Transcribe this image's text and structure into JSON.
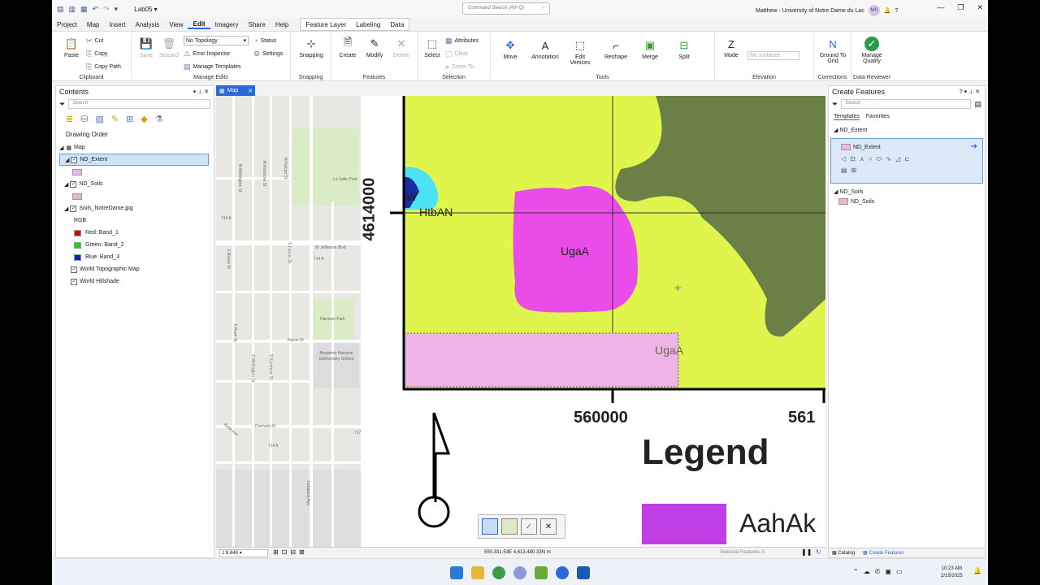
{
  "titlebar": {
    "project": "Lab05",
    "command_search": "Command Search (Alt+Q)",
    "user": "Matthew - University of Notre Dame du Lac",
    "initials": "MS"
  },
  "menu": [
    "Project",
    "Map",
    "Insert",
    "Analysis",
    "View",
    "Edit",
    "Imagery",
    "Share",
    "Help"
  ],
  "menu_active": "Edit",
  "context_tabs": [
    "Feature Layer",
    "Labeling",
    "Data"
  ],
  "ribbon": {
    "clipboard": {
      "paste": "Paste",
      "cut": "Cut",
      "copy": "Copy",
      "copy_path": "Copy Path",
      "label": "Clipboard"
    },
    "manage_edits": {
      "save": "Save",
      "discard": "Discard",
      "topology": "No Topology",
      "error_inspector": "Error Inspector",
      "manage_templates": "Manage Templates",
      "status": "Status",
      "settings": "Settings",
      "label": "Manage Edits"
    },
    "snapping": {
      "btn": "Snapping",
      "label": "Snapping"
    },
    "features": {
      "create": "Create",
      "modify": "Modify",
      "delete": "Delete",
      "label": "Features"
    },
    "selection": {
      "select": "Select",
      "attributes": "Attributes",
      "clear": "Clear",
      "zoom_to": "Zoom To",
      "label": "Selection"
    },
    "tools": {
      "move": "Move",
      "annotation": "Annotation",
      "edit_vertices": "Edit Vertices",
      "reshape": "Reshape",
      "merge": "Merge",
      "split": "Split",
      "label": "Tools"
    },
    "elevation": {
      "mode": "Mode",
      "surface": "No surfaces",
      "label": "Elevation"
    },
    "corrections": {
      "ground": "Ground To Grid",
      "label": "Corrections"
    },
    "data_reviewer": {
      "manage": "Manage Quality",
      "label": "Data Reviewer"
    }
  },
  "contents": {
    "title": "Contents",
    "search": "Search",
    "drawing_order": "Drawing Order",
    "map": "Map",
    "layers": [
      {
        "name": "ND_Extent",
        "swatch": "#f0b3e6"
      },
      {
        "name": "ND_Soils",
        "swatch": "#f0b3c4"
      },
      {
        "name": "Soils_NotreDame.jpg"
      }
    ],
    "rgb": "RGB",
    "bands": [
      {
        "label": "Red:  Band_1",
        "color": "#e00000"
      },
      {
        "label": "Green:  Band_2",
        "color": "#20d020"
      },
      {
        "label": "Blue:  Band_3",
        "color": "#1020c0"
      }
    ],
    "basemaps": [
      "World Topographic Map",
      "World Hillshade"
    ]
  },
  "map_tab": "Map",
  "map": {
    "soil_labels": [
      "W",
      "HtbAN",
      "UgaA",
      "UgaA"
    ],
    "y_coord": "4614000",
    "x_coords": [
      "560000",
      "561"
    ],
    "legend_title": "Legend",
    "legend_item": "AahAk",
    "streets": [
      "La Salle Park",
      "W Jefferson Blvd",
      "Harrison Park",
      "Huron St",
      "Benjamin Harrison Elementary School",
      "Dunham St",
      "N Wellington St",
      "N Kenmore St",
      "N Falcon St",
      "S Illinois St",
      "S Falcon St",
      "S Kenmore St",
      "S Wellington St",
      "Industrial Ave",
      "714 ft",
      "714 ft",
      "714 ft",
      "717",
      "Belle Ave",
      "S Rush St"
    ]
  },
  "statusbar": {
    "scale": "1:8,648",
    "coords": "550,331.53E 4,613,480.33N m",
    "selected": "Selected Features: 0"
  },
  "create_features": {
    "title": "Create Features",
    "search": "Search",
    "tabs": [
      "Templates",
      "Favorites"
    ],
    "groups": [
      {
        "name": "ND_Extent",
        "item": "ND_Extent",
        "swatch": "#f0b3e6"
      },
      {
        "name": "ND_Soils",
        "item": "ND_Soils",
        "swatch": "#f0b3c4"
      }
    ],
    "bottom_tabs": [
      "Catalog",
      "Create Features"
    ]
  },
  "taskbar": {
    "time": "10:23 AM",
    "date": "2/19/2025"
  }
}
